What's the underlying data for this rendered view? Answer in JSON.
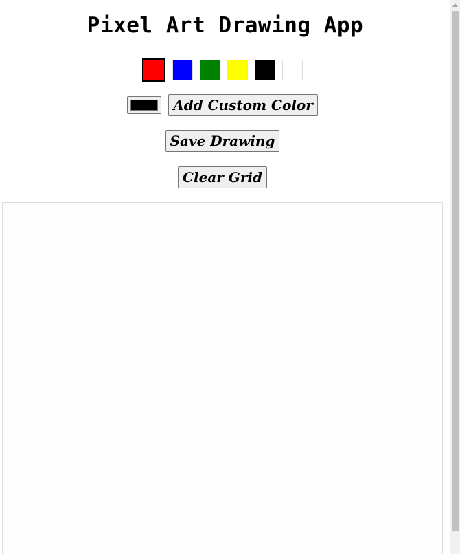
{
  "app": {
    "title": "Pixel Art Drawing App"
  },
  "palette": {
    "colors": [
      "#ff0000",
      "#0000ff",
      "#008000",
      "#ffff00",
      "#000000",
      "#ffffff"
    ],
    "selected": "#ff0000"
  },
  "custom_color": {
    "value": "#000000",
    "add_label": "Add Custom Color"
  },
  "actions": {
    "save_label": "Save Drawing",
    "clear_label": "Clear Grid"
  },
  "grid": {
    "background": "#fdfdfd"
  }
}
